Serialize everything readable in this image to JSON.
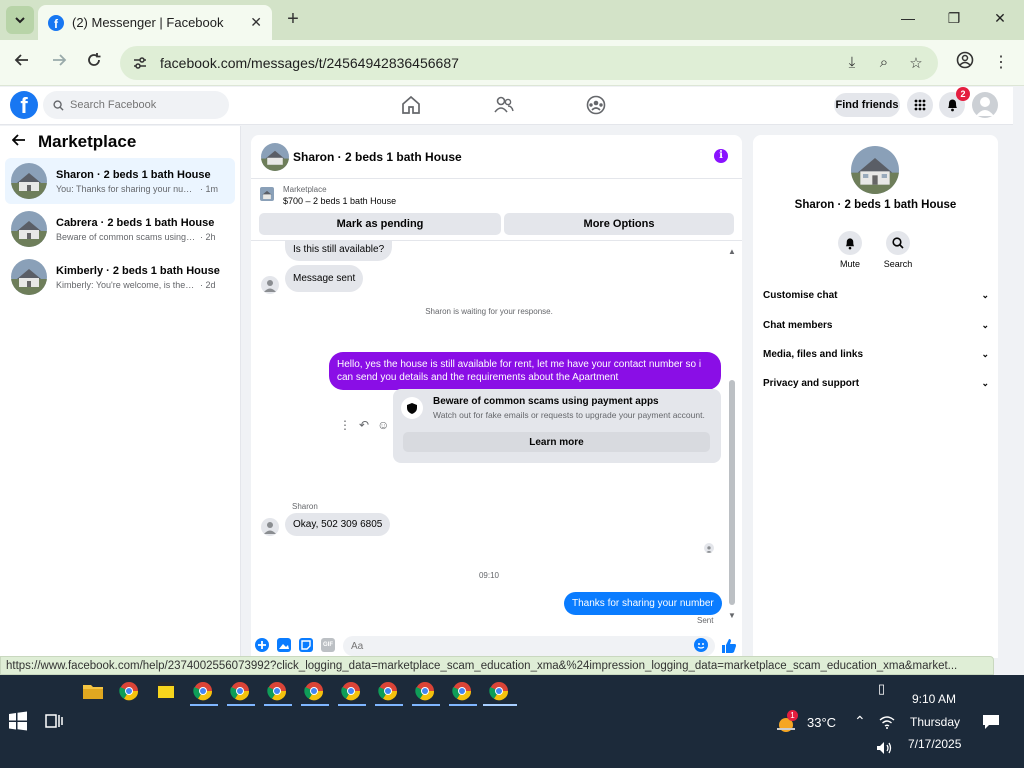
{
  "browser": {
    "tab_title": "(2) Messenger | Facebook",
    "url": "facebook.com/messages/t/24564942836456687",
    "status_url": "https://www.facebook.com/help/237400255607399​2?click_logging_data=marketplace_scam_education_xma&%24impression_logging_data=marketplace_scam_education_xma&market..."
  },
  "fb": {
    "search_placeholder": "Search Facebook",
    "find_friends": "Find friends",
    "notif_count": "2"
  },
  "sidebar": {
    "title": "Marketplace",
    "conversations": [
      {
        "name": "Sharon · 2 beds 1 bath House",
        "preview": "You: Thanks for sharing your number",
        "time": "· 1m"
      },
      {
        "name": "Cabrera · 2 beds 1 bath House",
        "preview": "Beware of common scams using pay...",
        "time": "· 2h"
      },
      {
        "name": "Kimberly · 2 beds 1 bath House",
        "preview": "Kimberly: You're welcome, is the hous...",
        "time": "· 2d"
      }
    ]
  },
  "chat": {
    "title": "Sharon · 2 beds 1 bath House",
    "listing_label": "Marketplace",
    "listing_price": "$700 – 2 beds 1 bath House",
    "btn_pending": "Mark as pending",
    "btn_more": "More Options",
    "msg_available": "Is this still available?",
    "msg_sent_note": "Message sent",
    "waiting_note": "Sharon is waiting for your response.",
    "msg_reply": "Hello, yes the house is still available for rent, let me have your contact number so i can send you details and the requirements about the  Apartment",
    "scam_title": "Beware of common scams using payment apps",
    "scam_sub": "Watch out for fake emails or requests to upgrade your payment account.",
    "learn_more": "Learn more",
    "sender_name": "Sharon",
    "msg_number": "Okay, 502 309 6805",
    "time_divider": "09:10",
    "msg_thanks": "Thanks for sharing your number",
    "sent_label": "Sent",
    "composer_placeholder": "Aa"
  },
  "details": {
    "name": "Sharon · 2 beds 1 bath House",
    "mute": "Mute",
    "search": "Search",
    "rows": [
      "Customise chat",
      "Chat members",
      "Media, files and links",
      "Privacy and support"
    ]
  },
  "taskbar": {
    "temperature": "33°C",
    "weather_badge": "1",
    "time": "9:10 AM",
    "day": "Thursday",
    "date": "7/17/2025"
  },
  "colors": {
    "fb_blue": "#1877f2",
    "purple_bubble": "#8a0ee6",
    "blue_bubble": "#0a7cff"
  }
}
